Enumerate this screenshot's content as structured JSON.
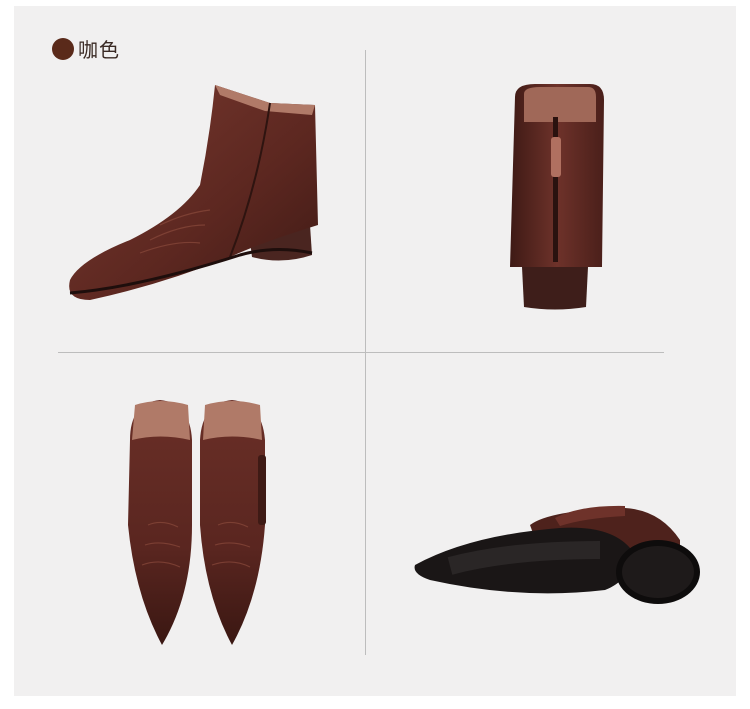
{
  "color_option": {
    "name": "咖色",
    "swatch_color": "#5a2a1a"
  },
  "views": [
    "side-view",
    "back-view",
    "top-view",
    "sole-view"
  ]
}
